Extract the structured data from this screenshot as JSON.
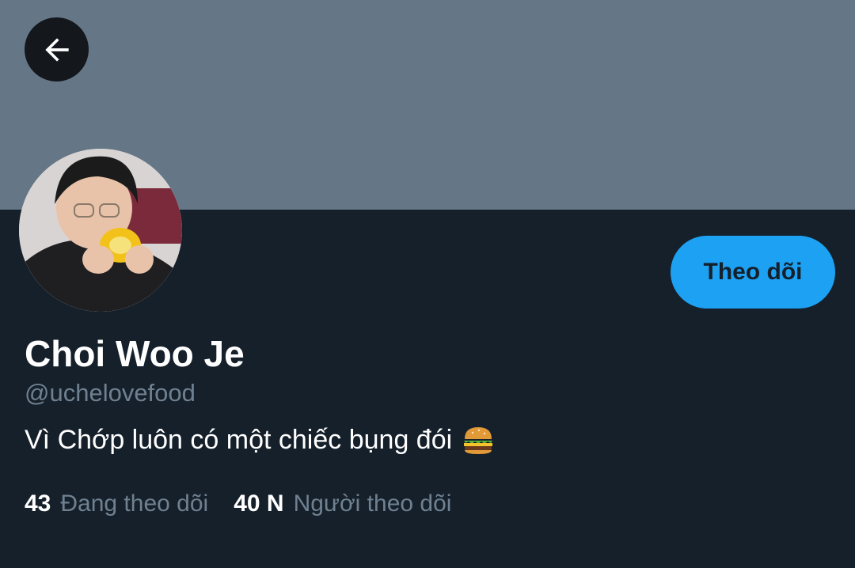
{
  "profile": {
    "display_name": "Choi Woo Je",
    "handle": "@uchelovefood",
    "bio": "Vì Chớp luôn có một chiếc bụng đói",
    "bio_emoji": "hamburger-icon",
    "follow_label": "Theo dõi",
    "following_count": "43",
    "following_label": "Đang theo dõi",
    "followers_count": "40 N",
    "followers_label": "Người theo dõi"
  },
  "colors": {
    "background": "#15202b",
    "banner": "#657786",
    "accent": "#1da1f2",
    "muted_text": "#6f8190"
  },
  "icons": {
    "back": "arrow-left-icon"
  }
}
